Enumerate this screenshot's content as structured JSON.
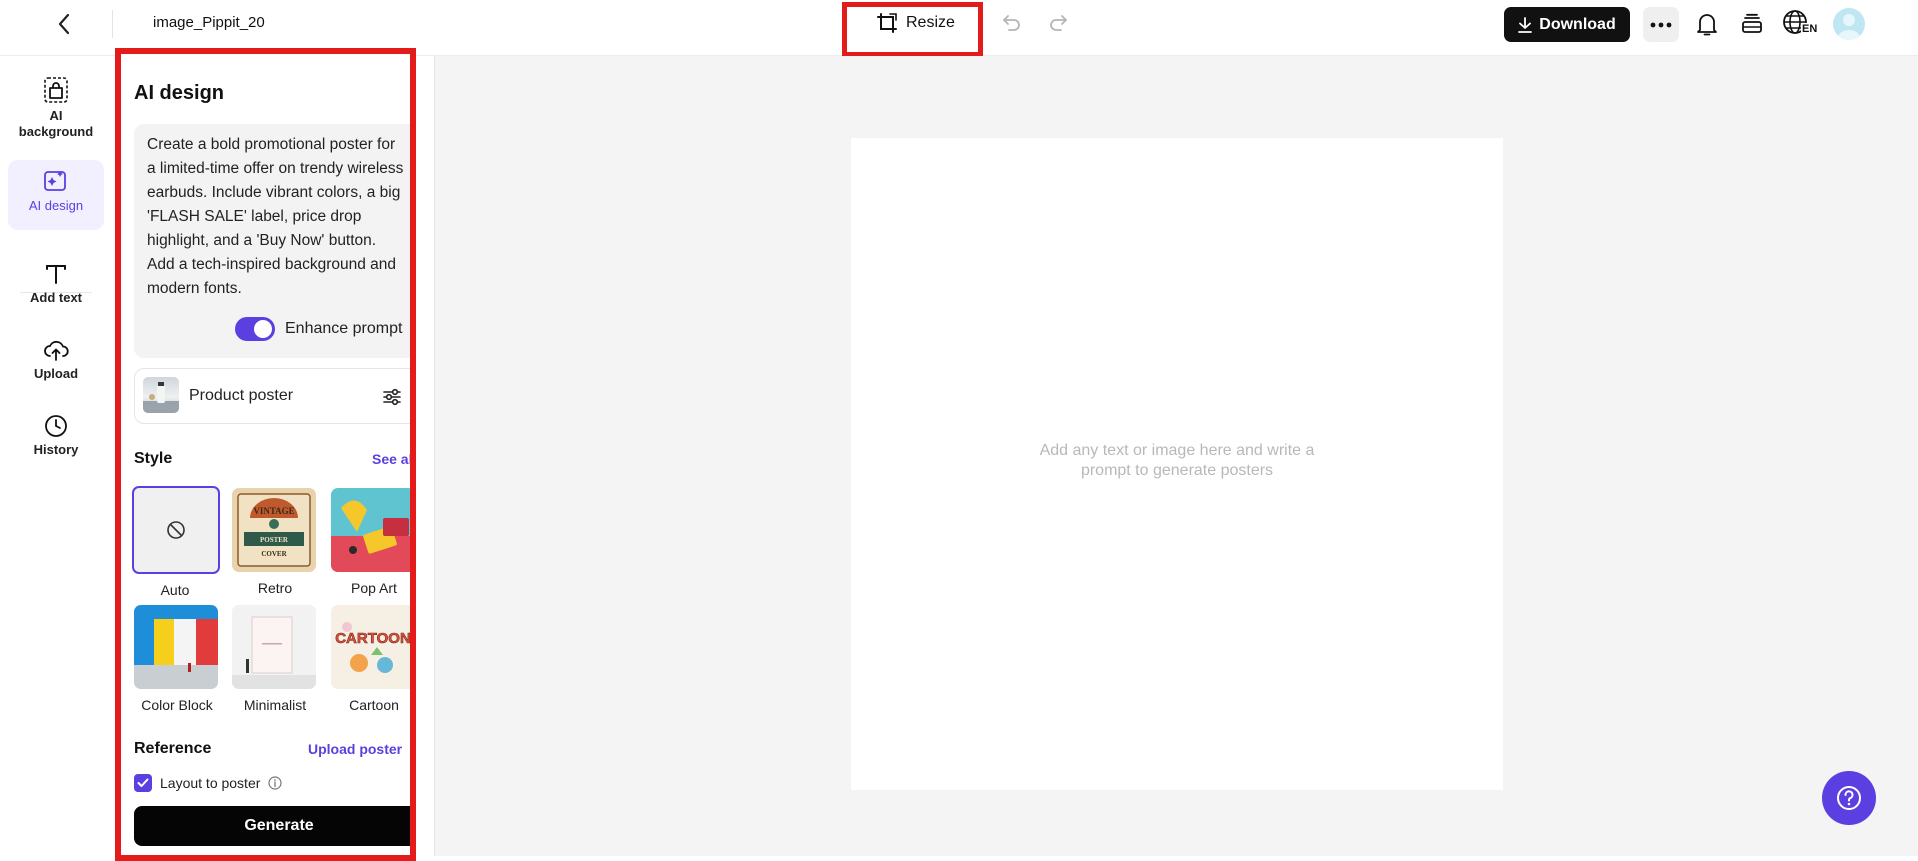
{
  "header": {
    "file_title": "image_Pippit_20",
    "resize_label": "Resize",
    "download_label": "Download",
    "language_label": "EN"
  },
  "rail": {
    "items": [
      {
        "label": "AI background",
        "icon": "ai-background-icon"
      },
      {
        "label": "AI design",
        "icon": "ai-design-icon",
        "active": true
      },
      {
        "label": "Add text",
        "icon": "text-icon"
      },
      {
        "label": "Upload",
        "icon": "upload-cloud-icon"
      },
      {
        "label": "History",
        "icon": "clock-icon"
      }
    ]
  },
  "panel": {
    "title": "AI design",
    "prompt": "Create a bold promotional poster for a limited-time offer on trendy wireless earbuds. Include vibrant colors, a big 'FLASH SALE' label, price drop highlight, and a 'Buy Now' button. Add a tech-inspired background and modern fonts.",
    "enhance_label": "Enhance prompt",
    "enhance_on": true,
    "poster_type": "Product poster",
    "style_title": "Style",
    "see_all": "See all",
    "styles": [
      {
        "label": "Auto",
        "selected": true
      },
      {
        "label": "Retro"
      },
      {
        "label": "Pop Art"
      },
      {
        "label": "Color Block"
      },
      {
        "label": "Minimalist"
      },
      {
        "label": "Cartoon"
      }
    ],
    "retro_thumb": {
      "line1": "VINTAGE",
      "line2": "POSTER",
      "line3": "COVER"
    },
    "cartoon_thumb": "CARTOON",
    "reference_title": "Reference",
    "upload_poster": "Upload poster",
    "layout_label": "Layout to poster",
    "layout_checked": true,
    "generate_label": "Generate"
  },
  "canvas": {
    "hint_line1": "Add any text or image here and write a",
    "hint_line2": "prompt to generate posters"
  },
  "colors": {
    "accent": "#5b3fe0",
    "highlight": "#e31b1b",
    "dark": "#111111"
  }
}
